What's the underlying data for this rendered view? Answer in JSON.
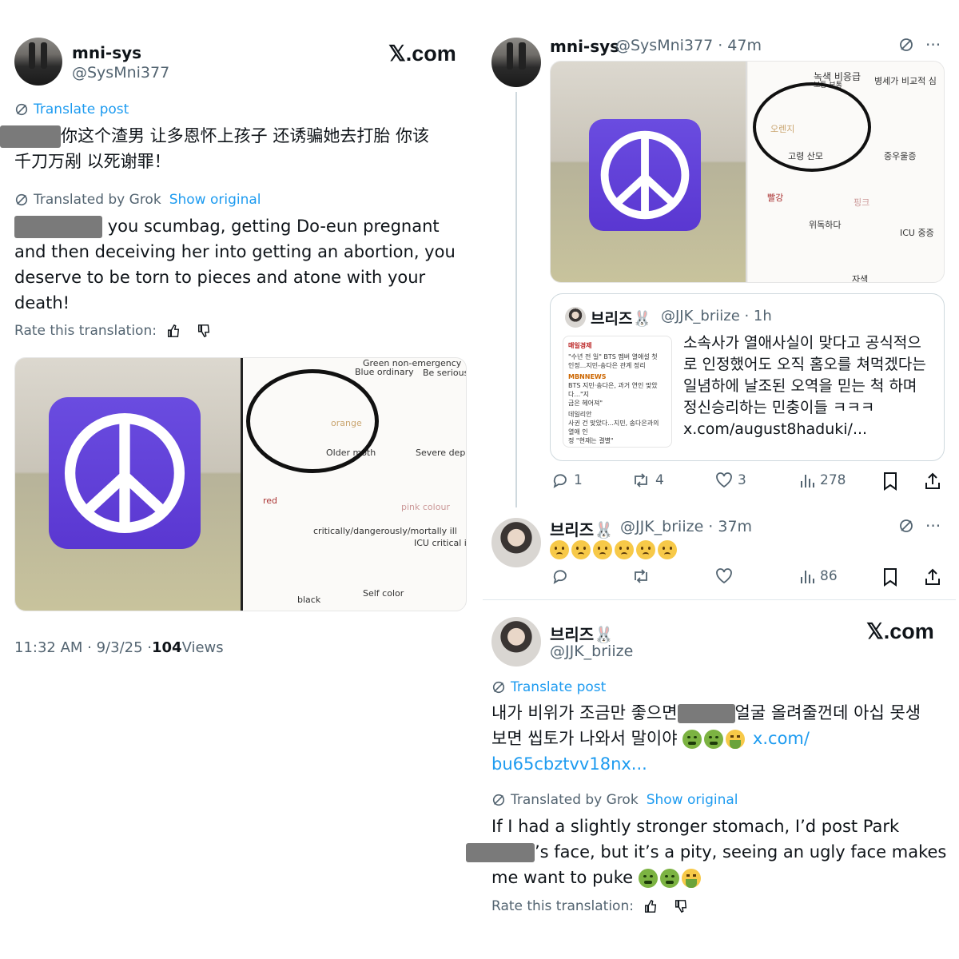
{
  "left_post": {
    "display_name": "mni-sys",
    "handle": "@SysMni377",
    "brand": "𝕏.com",
    "translate_label": "Translate post",
    "original_text": "你这个渣男 让多恩怀上孩子 还诱骗她去打胎 你该",
    "original_text_line2": "千刀万剐 以死谢罪！",
    "translated_by": "Translated by Grok",
    "show_original": "Show original",
    "translated_line1": "you scumbag, getting Do-eun pregnant",
    "translated_line2": "and then deceiving her into getting an abortion, you",
    "translated_line3": "deserve to be torn to pieces and atone with your",
    "translated_line4": "death!",
    "rate_label": "Rate this translation:",
    "timestamp": "11:32 AM · 9/3/25 · ",
    "views_count": "104",
    "views_label": " Views",
    "media_labels": {
      "green": "Green non-emergency",
      "blue": "Blue ordinary",
      "serious": "Be seriousl",
      "orange": "orange",
      "older": "Older moth",
      "severe": "Severe depressic",
      "red": "red",
      "pink": "pink colour",
      "critical": "critically/dangerously/mortally ill",
      "icu": "ICU critical illnes",
      "black": "black",
      "self": "Self color"
    }
  },
  "right_post": {
    "display_name": "mni-sys",
    "handle_time": "@SysMni377 · 47m",
    "media_labels": {
      "k1": "녹색 비응급",
      "k2": "병세가 비교적 심",
      "k3": "보통 보통",
      "k4": "오렌지",
      "k5": "고령 산모",
      "k6": "중우울증",
      "k7": "빨강",
      "k8": "핑크",
      "k9": "위독하다",
      "k10": "ICU 중증",
      "k11": "자색"
    },
    "quote": {
      "display_name": "브리즈🐰",
      "handle_time": "@JJK_briize · 1h",
      "text_line1": "소속사가 열애사실이 맞다고 공식적으",
      "text_line2": "로 인정했어도 오직 홈오를 쳐먹겠다는",
      "text_line3": "일념하에 날조된 오역을 믿는 척 하며",
      "text_line4": "정신승리하는 민충이들 ㅋㅋㅋ",
      "link": "x.com/august8haduki/...",
      "news_lines": [
        "매일경제",
        "\"수년 전 일\" BTS 멤버 열애설 첫",
        "인정...지민-송다은 관계 정리",
        "MBNNEWS",
        "BTS 지민·송다은, 과거 연인 맞았다...\"지",
        "금은 헤어져\"",
        "데일리안",
        "사귄 건 맞았다...지민, 송다은과의 열애 인",
        "정 \"현재는 결별\""
      ]
    },
    "actions": {
      "replies": "1",
      "reposts": "4",
      "likes": "3",
      "views": "278"
    }
  },
  "reply_post": {
    "display_name": "브리즈🐰",
    "handle_time": "@JJK_briize · 37m",
    "actions": {
      "views": "86"
    }
  },
  "bottom_post": {
    "display_name": "브리즈🐰",
    "handle": "@JJK_briize",
    "brand": "𝕏.com",
    "translate_label": "Translate post",
    "original_line1a": "내가 비위가 조금만 좋으면",
    "original_line1b": "얼굴 올려줄껀데 아십 못생",
    "original_line2": "보면 씹토가 나와서 말이야",
    "link_part1": "x.com/",
    "link_part2": "bu65cbztvv18nx...",
    "translated_by": "Translated by Grok",
    "show_original": "Show original",
    "translated_line1": "If I had a slightly stronger stomach, I’d post Park",
    "translated_line2": "’s face, but it’s a pity, seeing an ugly face makes",
    "translated_line3": "me want to puke",
    "rate_label": "Rate this translation:"
  },
  "colors": {
    "accent": "#1d9bf0",
    "secondary_text": "#536471",
    "peace_purple": "#5a37d1"
  }
}
